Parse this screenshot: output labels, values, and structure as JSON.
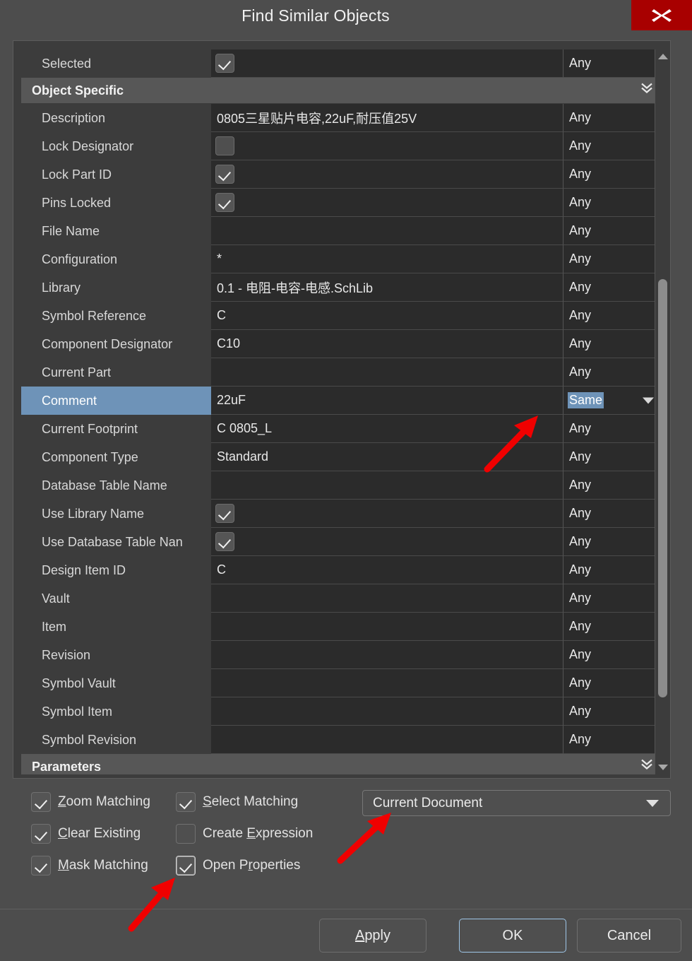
{
  "window": {
    "title": "Find Similar Objects",
    "close_label": "close-icon"
  },
  "grid": {
    "rows": [
      {
        "type": "row",
        "name": "Selected",
        "value": "",
        "widget": "checkbox-on",
        "condition": "Any"
      },
      {
        "type": "group",
        "name": "Object Specific"
      },
      {
        "type": "row",
        "name": "Description",
        "value": "0805三星贴片电容,22uF,耐压值25V",
        "widget": "text",
        "condition": "Any"
      },
      {
        "type": "row",
        "name": "Lock Designator",
        "value": "",
        "widget": "checkbox-off",
        "condition": "Any"
      },
      {
        "type": "row",
        "name": "Lock Part ID",
        "value": "",
        "widget": "checkbox-on",
        "condition": "Any"
      },
      {
        "type": "row",
        "name": "Pins Locked",
        "value": "",
        "widget": "checkbox-on",
        "condition": "Any"
      },
      {
        "type": "row",
        "name": "File Name",
        "value": "",
        "widget": "text",
        "condition": "Any"
      },
      {
        "type": "row",
        "name": "Configuration",
        "value": "*",
        "widget": "text",
        "condition": "Any"
      },
      {
        "type": "row",
        "name": "Library",
        "value": "0.1 - 电阻-电容-电感.SchLib",
        "widget": "text",
        "condition": "Any"
      },
      {
        "type": "row",
        "name": "Symbol Reference",
        "value": "C",
        "widget": "text",
        "condition": "Any"
      },
      {
        "type": "row",
        "name": "Component Designator",
        "value": "C10",
        "widget": "text",
        "condition": "Any"
      },
      {
        "type": "row",
        "name": "Current Part",
        "value": "",
        "widget": "text",
        "condition": "Any"
      },
      {
        "type": "row",
        "name": "Comment",
        "value": "22uF",
        "widget": "text",
        "condition": "Same",
        "selected": true,
        "dropdown": true
      },
      {
        "type": "row",
        "name": "Current Footprint",
        "value": "C 0805_L",
        "widget": "text",
        "condition": "Any"
      },
      {
        "type": "row",
        "name": "Component Type",
        "value": "Standard",
        "widget": "text",
        "condition": "Any"
      },
      {
        "type": "row",
        "name": "Database Table Name",
        "value": "",
        "widget": "text",
        "condition": "Any"
      },
      {
        "type": "row",
        "name": "Use Library Name",
        "value": "",
        "widget": "checkbox-on",
        "condition": "Any"
      },
      {
        "type": "row",
        "name": "Use Database Table Nan",
        "value": "",
        "widget": "checkbox-on",
        "condition": "Any"
      },
      {
        "type": "row",
        "name": "Design Item ID",
        "value": "C",
        "widget": "text",
        "condition": "Any"
      },
      {
        "type": "row",
        "name": "Vault",
        "value": "",
        "widget": "text",
        "condition": "Any"
      },
      {
        "type": "row",
        "name": "Item",
        "value": "",
        "widget": "text",
        "condition": "Any"
      },
      {
        "type": "row",
        "name": "Revision",
        "value": "",
        "widget": "text",
        "condition": "Any"
      },
      {
        "type": "row",
        "name": "Symbol Vault",
        "value": "",
        "widget": "text",
        "condition": "Any"
      },
      {
        "type": "row",
        "name": "Symbol Item",
        "value": "",
        "widget": "text",
        "condition": "Any"
      },
      {
        "type": "row",
        "name": "Symbol Revision",
        "value": "",
        "widget": "text",
        "condition": "Any"
      },
      {
        "type": "group",
        "name": "Parameters"
      }
    ],
    "scrollbar": {
      "up_icon": "triangle-up-icon",
      "down_icon": "triangle-down-icon"
    }
  },
  "options": {
    "checkboxes": [
      {
        "label": "Zoom Matching",
        "accel": "Z",
        "checked": true,
        "focused": false
      },
      {
        "label": "Select Matching",
        "accel": "S",
        "checked": true,
        "focused": false
      },
      {
        "label": "Clear Existing",
        "accel": "C",
        "checked": true,
        "focused": false
      },
      {
        "label": "Create Expression",
        "accel": "E",
        "checked": false,
        "focused": false
      },
      {
        "label": "Mask Matching",
        "accel": "M",
        "checked": true,
        "focused": false
      },
      {
        "label": "Open Properties",
        "accel": "r",
        "checked": true,
        "focused": true
      }
    ],
    "scope": {
      "value": "Current Document",
      "caret_icon": "chevron-down-icon"
    }
  },
  "footer": {
    "apply_label": "Apply",
    "apply_accel": "A",
    "ok_label": "OK",
    "cancel_label": "Cancel"
  },
  "annotations": {
    "arrow_color": "#f00000",
    "arrows": [
      {
        "name": "arrow-to-same-condition"
      },
      {
        "name": "arrow-to-open-properties"
      },
      {
        "name": "arrow-to-current-document"
      }
    ]
  }
}
